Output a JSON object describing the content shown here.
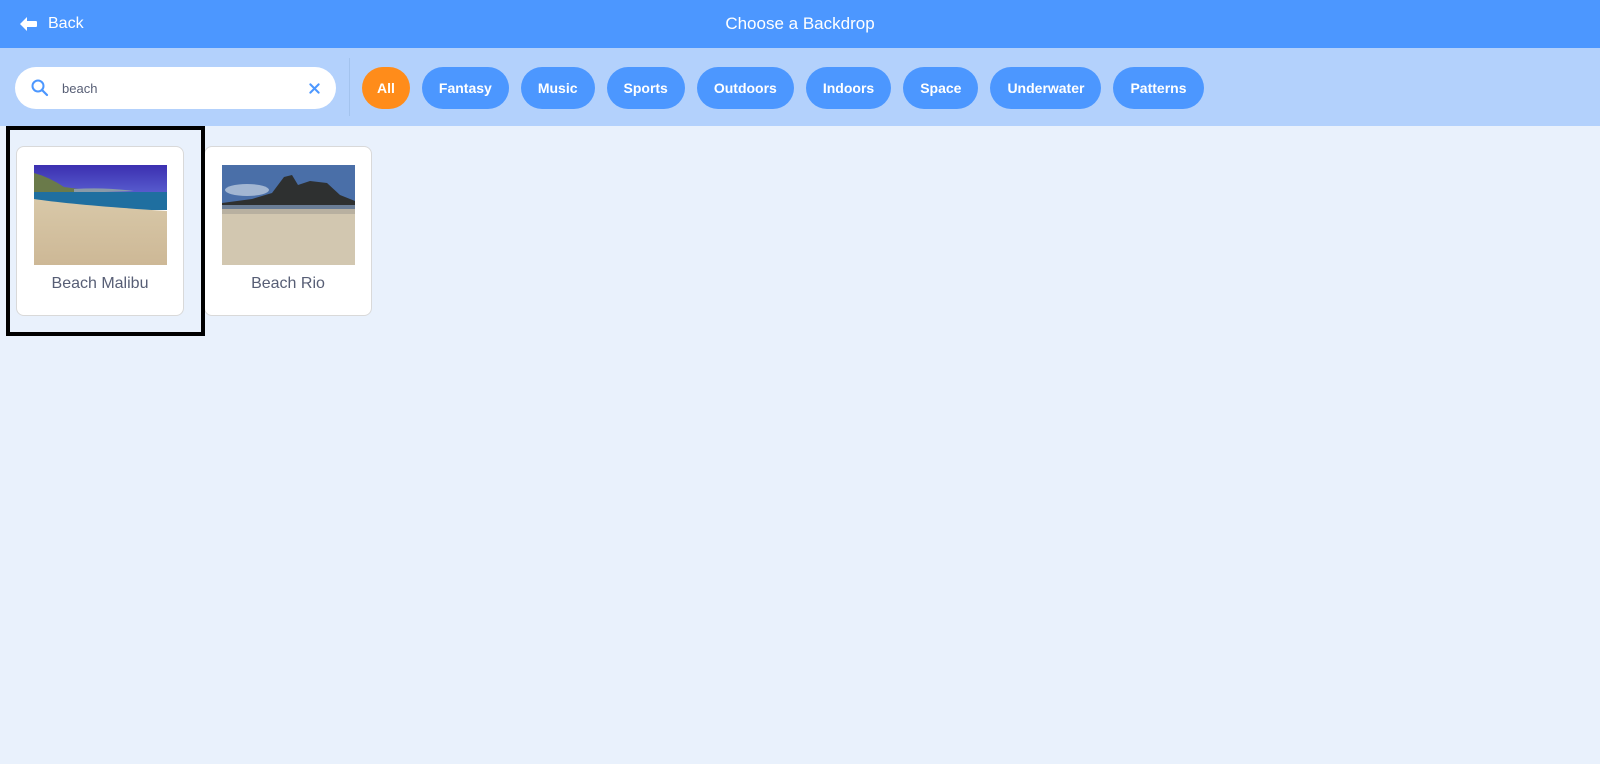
{
  "header": {
    "back_label": "Back",
    "back_icon": "arrow-left-icon",
    "title": "Choose a Backdrop"
  },
  "search": {
    "icon": "search-icon",
    "value": "beach",
    "placeholder": "Search",
    "clear_icon": "close-icon"
  },
  "tags": [
    {
      "label": "All",
      "active": true
    },
    {
      "label": "Fantasy",
      "active": false
    },
    {
      "label": "Music",
      "active": false
    },
    {
      "label": "Sports",
      "active": false
    },
    {
      "label": "Outdoors",
      "active": false
    },
    {
      "label": "Indoors",
      "active": false
    },
    {
      "label": "Space",
      "active": false
    },
    {
      "label": "Underwater",
      "active": false
    },
    {
      "label": "Patterns",
      "active": false
    }
  ],
  "backdrops": [
    {
      "name": "Beach Malibu",
      "selected": true
    },
    {
      "name": "Beach Rio",
      "selected": false
    }
  ],
  "colors": {
    "header_bg": "#4c97ff",
    "filterbar_bg": "#b3d1fc",
    "page_bg": "#e9f1fc",
    "tag_bg": "#4c97ff",
    "tag_active_bg": "#ff8c1a",
    "card_label": "#575e75"
  }
}
